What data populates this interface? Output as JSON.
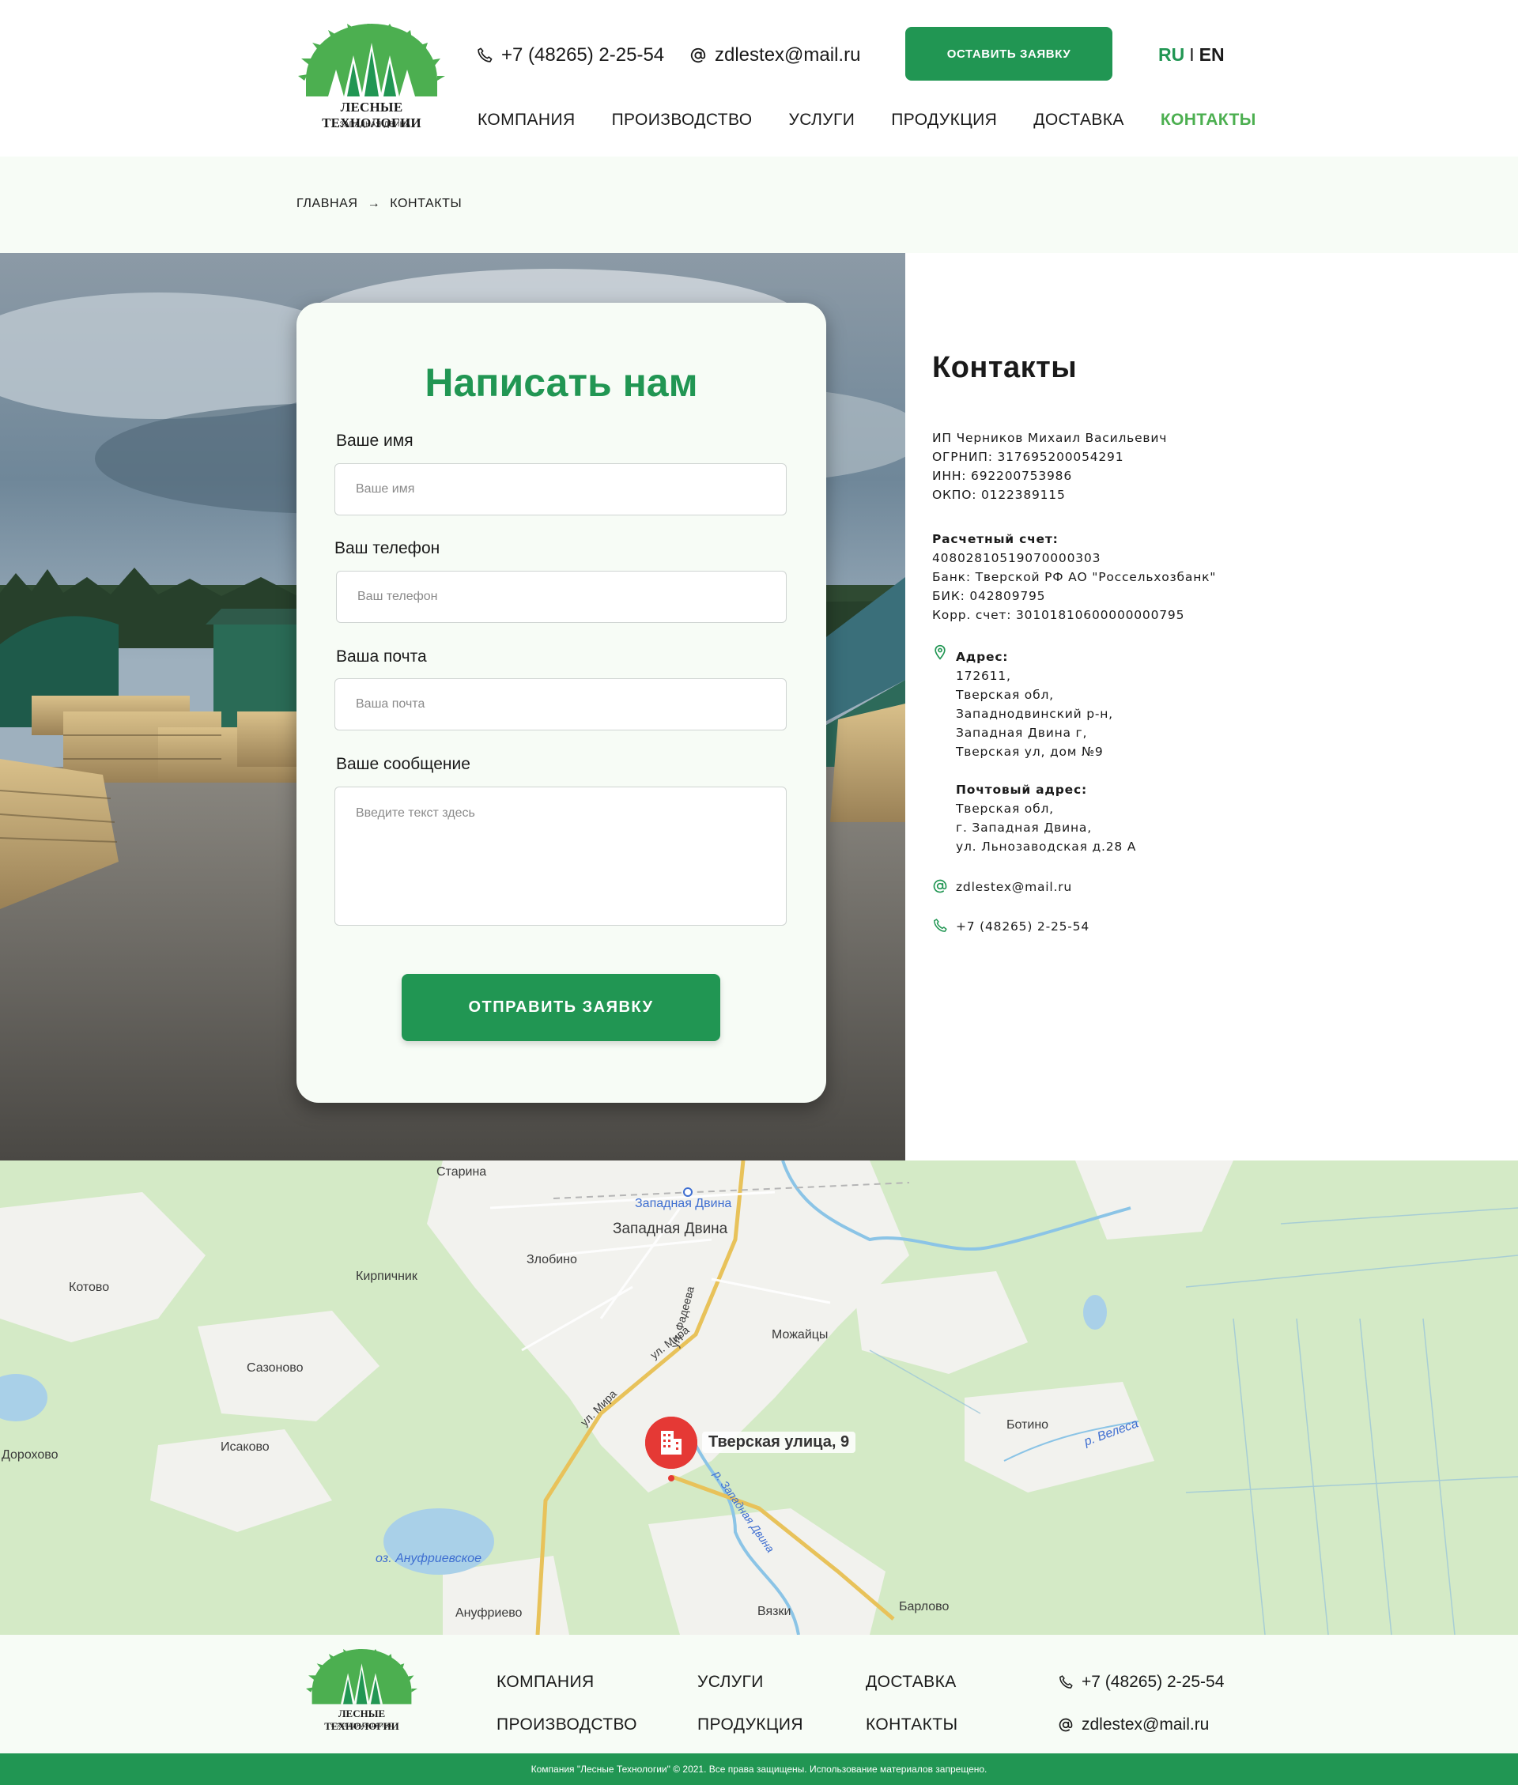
{
  "header": {
    "logo_text": "ЛЕСНЫЕ ТЕХНОЛОГИИ",
    "logo_subtext": "г. ЗАПАДНАЯ ДВИНА",
    "phone": "+7 (48265) 2-25-54",
    "email": "zdlestex@mail.ru",
    "cta_button": "ОСТАВИТЬ ЗАЯВКУ",
    "lang_ru": "RU",
    "lang_sep": "I",
    "lang_en": "EN"
  },
  "nav": [
    "КОМПАНИЯ",
    "ПРОИЗВОДСТВО",
    "УСЛУГИ",
    "ПРОДУКЦИЯ",
    "ДОСТАВКА",
    "КОНТАКТЫ"
  ],
  "breadcrumb": {
    "home": "ГЛАВНАЯ",
    "arrow": "→",
    "current": "КОНТАКТЫ"
  },
  "form": {
    "title": "Написать нам",
    "name_label": "Ваше имя",
    "name_placeholder": "Ваше имя",
    "phone_label": "Ваш телефон",
    "phone_placeholder": "Ваш телефон",
    "email_label": "Ваша почта",
    "email_placeholder": "Ваша почта",
    "message_label": "Ваше сообщение",
    "message_placeholder": "Введите текст здесь",
    "submit": "ОТПРАВИТЬ ЗАЯВКУ"
  },
  "contacts": {
    "title": "Контакты",
    "owner": "ИП Черников Михаил Васильевич",
    "ogrnip": "ОГРНИП: 317695200054291",
    "inn": "ИНН: 692200753986",
    "okpo": "ОКПО: 0122389115",
    "account_label": "Расчетный счет:",
    "account": "40802810519070000303",
    "bank": "Банк: Тверской РФ АО \"Россельхозбанк\"",
    "bik": "БИК: 042809795",
    "corr": "Корр. счет: 30101810600000000795",
    "address_label": "Адрес:",
    "address_lines": [
      "172611,",
      "Тверская обл,",
      "Западнодвинский р-н,",
      "Западная Двина г,",
      "Тверская ул, дом №9"
    ],
    "postal_label": "Почтовый адрес:",
    "postal_lines": [
      "Тверская обл,",
      "г. Западная Двина,",
      "ул. Льнозаводская д.28 А"
    ],
    "email": "zdlestex@mail.ru",
    "phone": "+7 (48265) 2-25-54"
  },
  "map": {
    "marker_label": "Тверская улица, 9",
    "places": [
      "Старина",
      "Западная Двина",
      "Западная Двина",
      "Злобино",
      "Кирпичник",
      "Котово",
      "ул. Фадеева",
      "ул. Мира",
      "ул. Мира",
      "Можайцы",
      "Сазоново",
      "Исаково",
      "Дорохово",
      "Ботино",
      "р. Велеса",
      "р. Западная Двина",
      "оз. Ануфриевское",
      "Ануфриево",
      "Вязки",
      "Барлово"
    ]
  },
  "footer": {
    "logo_text": "ЛЕСНЫЕ ТЕХНОЛОГИИ",
    "logo_subtext": "г. ЗАПАДНАЯ ДВИНА",
    "nav": [
      "КОМПАНИЯ",
      "ПРОИЗВОДСТВО",
      "УСЛУГИ",
      "ПРОДУКЦИЯ",
      "ДОСТАВКА",
      "КОНТАКТЫ"
    ],
    "phone": "+7 (48265) 2-25-54",
    "email": "zdlestex@mail.ru",
    "copyright": "Компания \"Лесные Технологии\" © 2021. Все права защищены. Использование материалов запрещено."
  },
  "colors": {
    "brand": "#219653",
    "accent_light": "#4caf50",
    "bg_light": "#f7fcf6",
    "marker": "#e53935"
  }
}
